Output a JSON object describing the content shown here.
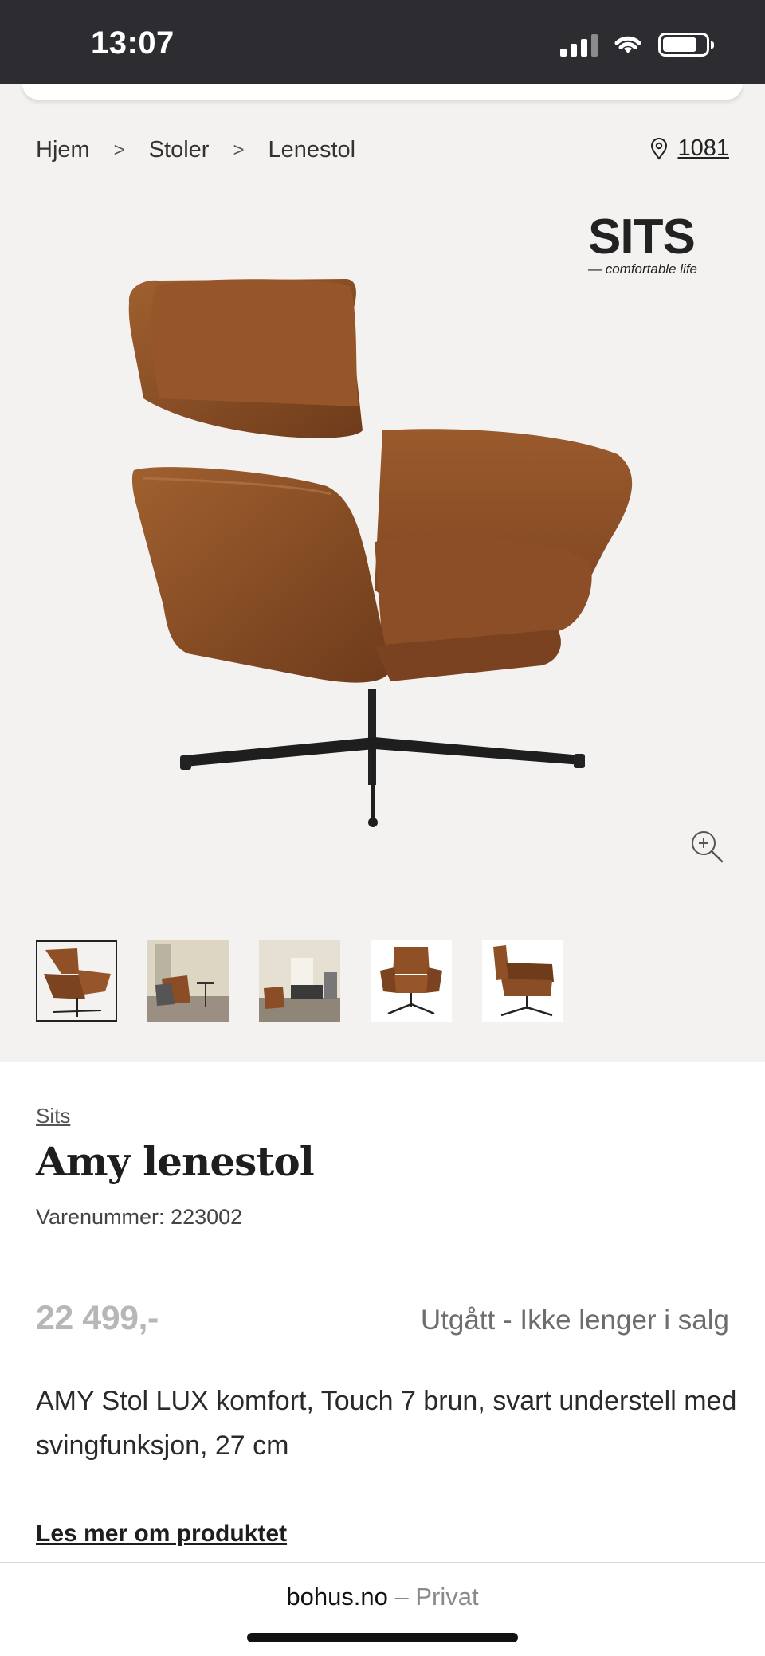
{
  "status_bar": {
    "time": "13:07"
  },
  "breadcrumb": {
    "items": [
      "Hjem",
      "Stoler",
      "Lenestol"
    ],
    "separator": ">"
  },
  "store": {
    "value": "1081",
    "icon": "location-pin-icon"
  },
  "brand_logo": {
    "wordmark": "SITS",
    "tagline": "— comfortable life"
  },
  "gallery": {
    "zoom_icon": "zoom-in-icon",
    "thumbnails": [
      {
        "label": "chair-side",
        "selected": true
      },
      {
        "label": "chair-room-1",
        "selected": false
      },
      {
        "label": "chair-room-2",
        "selected": false
      },
      {
        "label": "chair-front",
        "selected": false
      },
      {
        "label": "chair-profile",
        "selected": false
      }
    ]
  },
  "product": {
    "brand": "Sits",
    "title": "Amy lenestol",
    "sku": "Varenummer: 223002",
    "price": "22 499,-",
    "status": "Utgått - Ikke lenger i salg",
    "description": "AMY Stol LUX komfort, Touch 7 brun, svart understell med svingfunksjon, 27 cm",
    "read_more": "Les mer om produktet"
  },
  "url_bar": {
    "domain": "bohus.no",
    "suffix": "– Privat"
  },
  "colors": {
    "leather": "#8a4d25",
    "hero_bg": "#f4f2f1",
    "price_gray": "#b7b7b7"
  }
}
